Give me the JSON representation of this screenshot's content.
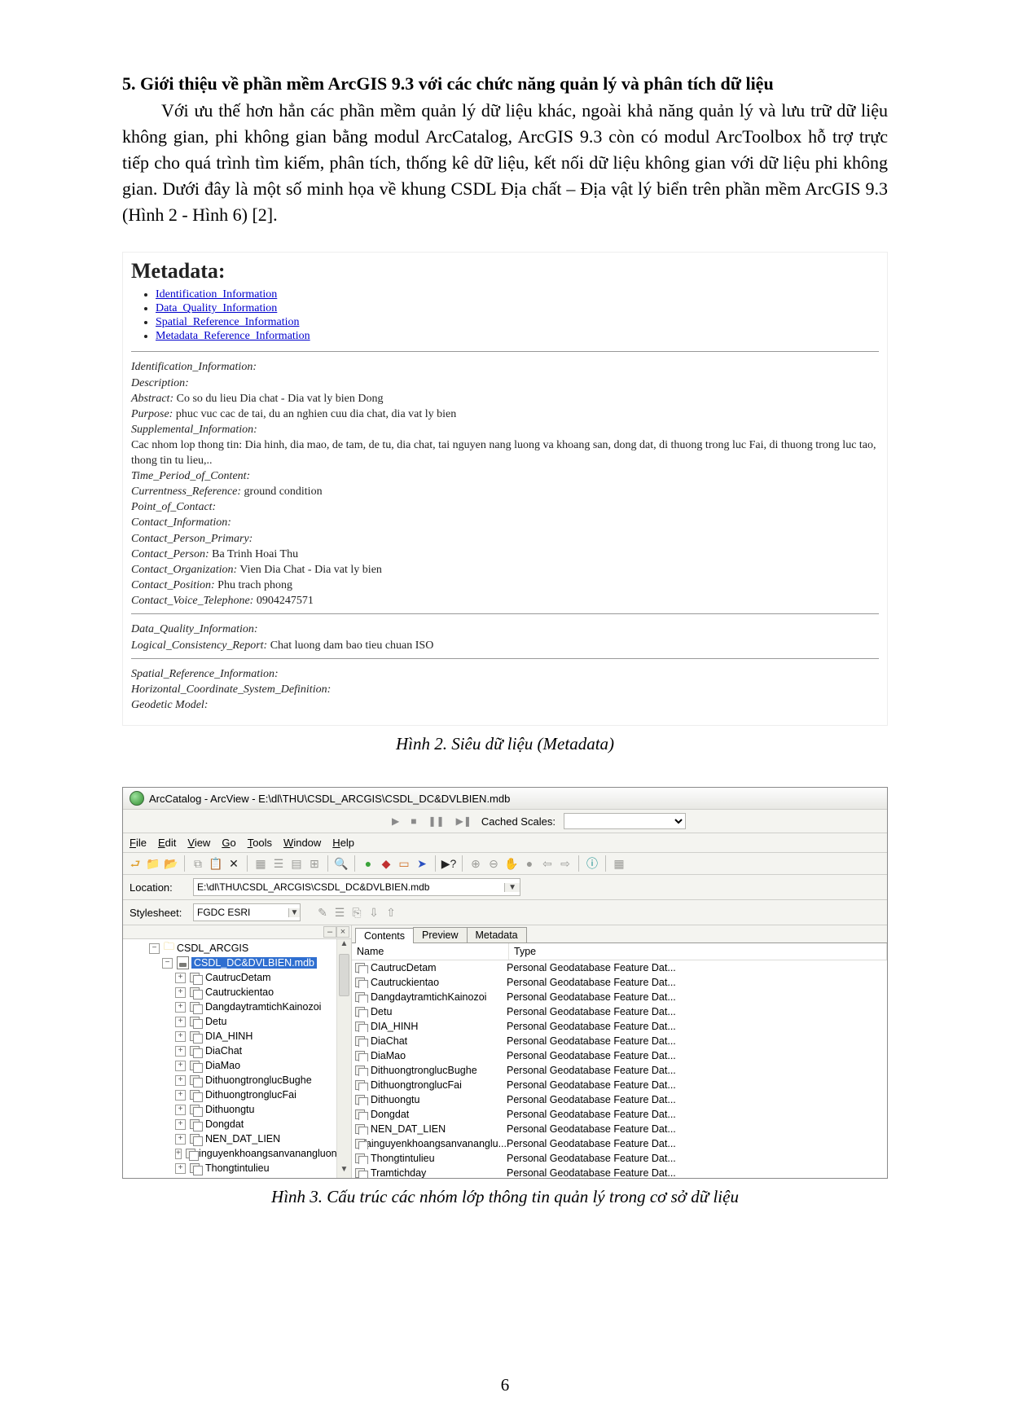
{
  "heading": "5. Giới thiệu về phần mềm ArcGIS 9.3 với các chức năng quản lý và phân tích dữ liệu",
  "body": "Với ưu thế hơn hẳn các phần mềm quản lý dữ liệu khác, ngoài khả năng quản lý và lưu trữ dữ liệu không gian, phi không gian bằng modul ArcCatalog, ArcGIS 9.3 còn có modul ArcToolbox hỗ trợ trực tiếp cho quá trình tìm kiếm, phân tích, thống kê dữ liệu, kết nối dữ liệu không gian với dữ liệu phi không gian. Dưới đây là một số minh họa về khung CSDL Địa chất – Địa vật lý biển trên phần mềm ArcGIS 9.3 (Hình 2 - Hình 6) [2].",
  "metadata": {
    "title": "Metadata:",
    "links": [
      "Identification_Information",
      "Data_Quality_Information",
      "Spatial_Reference_Information",
      "Metadata_Reference_Information"
    ],
    "id_info_label": "Identification_Information:",
    "description_label": "Description:",
    "abstract_label": "Abstract:",
    "abstract_value": "Co so du lieu Dia chat - Dia vat ly bien Dong",
    "purpose_label": "Purpose:",
    "purpose_value": "phuc vuc cac de tai, du an nghien cuu dia chat, dia vat ly bien",
    "supplemental_label": "Supplemental_Information:",
    "supplemental_value": "Cac nhom lop thong tin: Dia hinh, dia mao, de tam, de tu, dia chat, tai nguyen nang luong va khoang san, dong dat, di thuong trong luc Fai, di thuong trong luc tao, thong tin tu lieu,..",
    "time_label": "Time_Period_of_Content:",
    "currentness_label": "Currentness_Reference:",
    "currentness_value": "ground condition",
    "poc_label": "Point_of_Contact:",
    "contact_info_label": "Contact_Information:",
    "contact_primary_label": "Contact_Person_Primary:",
    "contact_person_label": "Contact_Person:",
    "contact_person_value": "Ba Trinh Hoai Thu",
    "contact_org_label": "Contact_Organization:",
    "contact_org_value": "Vien Dia Chat - Dia vat ly bien",
    "contact_pos_label": "Contact_Position:",
    "contact_pos_value": "Phu trach phong",
    "contact_tel_label": "Contact_Voice_Telephone:",
    "contact_tel_value": "0904247571",
    "dq_label": "Data_Quality_Information:",
    "logical_label": "Logical_Consistency_Report:",
    "logical_value": "Chat luong dam bao tieu chuan ISO",
    "sr_label": "Spatial_Reference_Information:",
    "hcsd_label": "Horizontal_Coordinate_System_Definition:",
    "geo_label": "Geodetic Model:"
  },
  "caption2": "Hình 2. Siêu dữ liệu (Metadata)",
  "arccat": {
    "title": "ArcCatalog - ArcView - E:\\dl\\THU\\CSDL_ARCGIS\\CSDL_DC&DVLBIEN.mdb",
    "cached_label": "Cached Scales:",
    "menu": [
      "File",
      "Edit",
      "View",
      "Go",
      "Tools",
      "Window",
      "Help"
    ],
    "location_label": "Location:",
    "location_value": "E:\\dl\\THU\\CSDL_ARCGIS\\CSDL_DC&DVLBIEN.mdb",
    "stylesheet_label": "Stylesheet:",
    "stylesheet_value": "FGDC ESRI",
    "tree_root": "CSDL_ARCGIS",
    "tree_mdb": "CSDL_DC&DVLBIEN.mdb",
    "tree_items": [
      "CautrucDetam",
      "Cautruckientao",
      "DangdaytramtichKainozoi",
      "Detu",
      "DIA_HINH",
      "DiaChat",
      "DiaMao",
      "DithuongtronglucBughe",
      "DithuongtronglucFai",
      "Dithuongtu",
      "Dongdat",
      "NEN_DAT_LIEN",
      "Tainguyenkhoangsanvanangluong",
      "Thongtintulieu"
    ],
    "tabs": [
      "Contents",
      "Preview",
      "Metadata"
    ],
    "col_name": "Name",
    "col_type": "Type",
    "type_text": "Personal Geodatabase Feature Dat...",
    "list": [
      "CautrucDetam",
      "Cautruckientao",
      "DangdaytramtichKainozoi",
      "Detu",
      "DIA_HINH",
      "DiaChat",
      "DiaMao",
      "DithuongtronglucBughe",
      "DithuongtronglucFai",
      "Dithuongtu",
      "Dongdat",
      "NEN_DAT_LIEN",
      "Tainguyenkhoangsanvananglu...",
      "Thongtintulieu",
      "Tramtichday"
    ]
  },
  "caption3": "Hình 3. Cấu trúc các nhóm lớp thông tin quản lý trong cơ sở dữ liệu",
  "page_num": "6"
}
